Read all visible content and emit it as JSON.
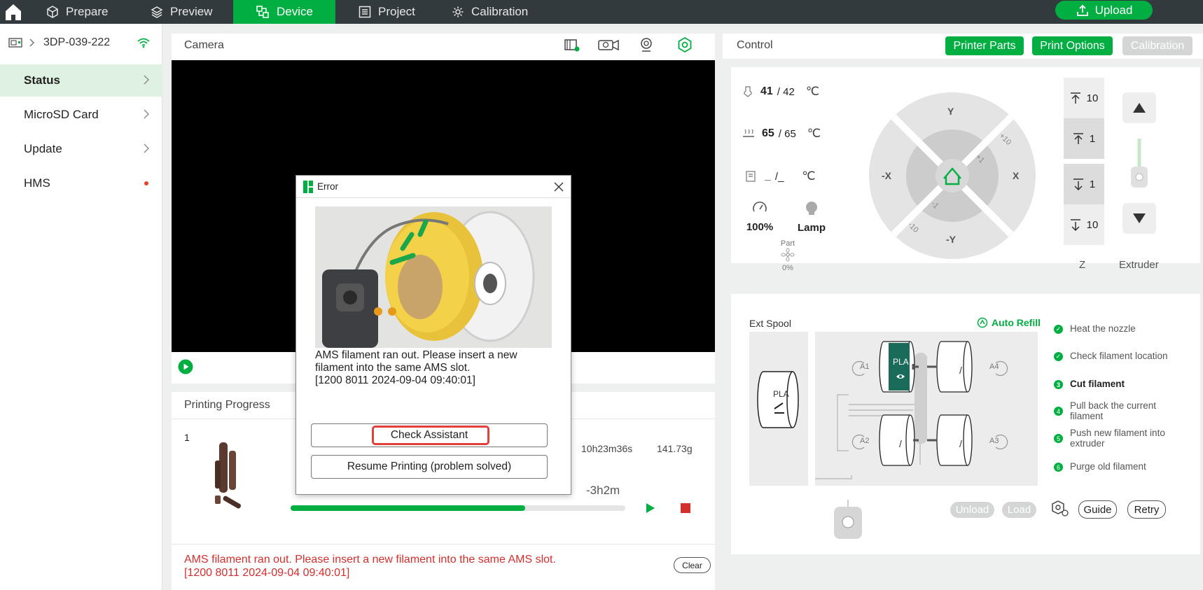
{
  "topbar": {
    "tabs": [
      {
        "label": "Prepare"
      },
      {
        "label": "Preview"
      },
      {
        "label": "Device"
      },
      {
        "label": "Project"
      },
      {
        "label": "Calibration"
      }
    ],
    "upload_label": "Upload",
    "accent": "#00ae42"
  },
  "sidebar": {
    "device_name": "3DP-039-222",
    "items": [
      {
        "label": "Status"
      },
      {
        "label": "MicroSD Card"
      },
      {
        "label": "Update"
      },
      {
        "label": "HMS"
      }
    ]
  },
  "camera": {
    "title": "Camera"
  },
  "progress": {
    "title": "Printing Progress",
    "plate": "1",
    "time_total": "10h23m36s",
    "weight": "141.73g",
    "remaining": "-3h2m",
    "progress_fraction": 0.7,
    "error_message": "AMS filament ran out. Please insert a new filament into the same AMS slot.",
    "error_code": "[1200 8011 2024-09-04 09:40:01]",
    "clear_label": "Clear"
  },
  "control": {
    "title": "Control",
    "buttons": {
      "printer_parts": "Printer Parts",
      "print_options": "Print Options",
      "calibration": "Calibration"
    },
    "nozzle": {
      "current": "41",
      "target": "/ 42",
      "unit": "℃"
    },
    "bed": {
      "current": "65",
      "target": "/ 65",
      "unit": "℃"
    },
    "chamber": {
      "current": "_",
      "target": "/_",
      "unit": "℃"
    },
    "speed": "100%",
    "lamp": "Lamp",
    "fan": {
      "label": "Part",
      "value": "0%"
    },
    "jog": {
      "y_plus": "Y",
      "y_minus": "-Y",
      "x_plus": "X",
      "x_minus": "-X",
      "plus10": "+10",
      "plus1": "+1",
      "minus1": "-1",
      "minus10": "-10"
    },
    "z_steps": [
      "10",
      "1",
      "1",
      "10"
    ],
    "z_label": "Z",
    "extruder_label": "Extruder"
  },
  "ams": {
    "ext_spool_label": "Ext Spool",
    "ext_filament": "PLA",
    "auto_refill": "Auto Refill",
    "slots": {
      "a1": "A1",
      "a2": "A2",
      "a3": "A3",
      "a4": "A4"
    },
    "a1_filament": "PLA",
    "empty_mark": "/",
    "slot_color": "#1a6b5a",
    "steps": [
      {
        "num": "1",
        "label": "Heat the nozzle"
      },
      {
        "num": "2",
        "label": "Check filament location"
      },
      {
        "num": "3",
        "label": "Cut filament"
      },
      {
        "num": "4",
        "label": "Pull back the current filament"
      },
      {
        "num": "5",
        "label": "Push new filament into extruder"
      },
      {
        "num": "6",
        "label": "Purge old filament"
      }
    ],
    "unload_label": "Unload",
    "load_label": "Load",
    "guide_label": "Guide",
    "retry_label": "Retry"
  },
  "dialog": {
    "title": "Error",
    "message": "AMS filament ran out. Please insert a new filament into the same AMS slot.",
    "code": "[1200 8011 2024-09-04 09:40:01]",
    "check_assistant": "Check Assistant",
    "resume": "Resume Printing (problem solved)"
  }
}
